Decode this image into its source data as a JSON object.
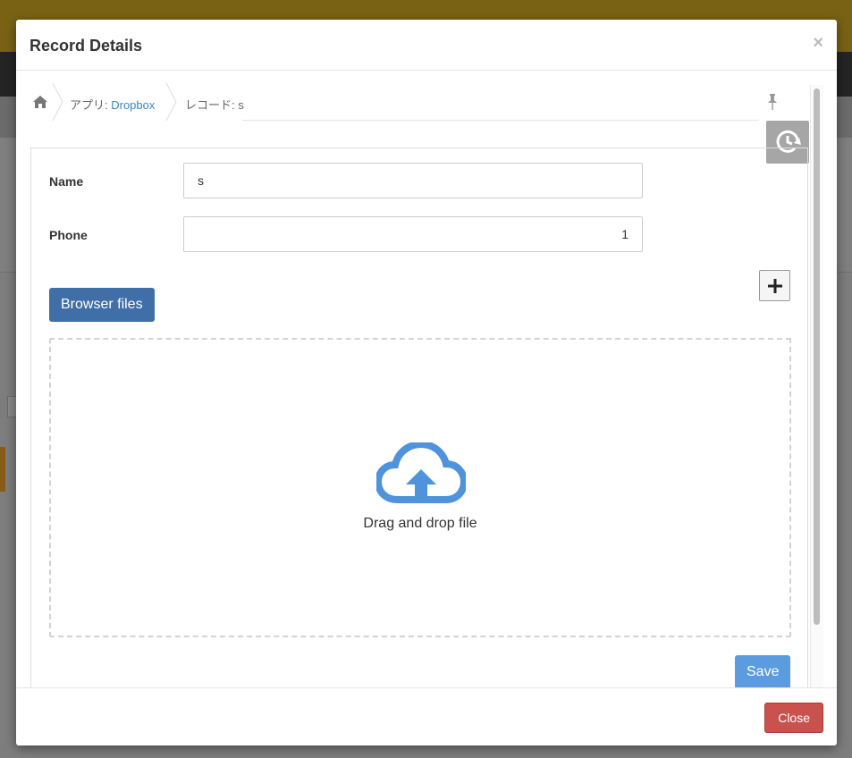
{
  "modal": {
    "title": "Record Details",
    "close_symbol": "×"
  },
  "breadcrumb": {
    "home_icon": "home-icon",
    "app_prefix": "アプリ: ",
    "app_link": "Dropbox",
    "record_label": "レコード: s"
  },
  "form": {
    "name_label": "Name",
    "name_value": "s",
    "phone_label": "Phone",
    "phone_value": "1",
    "browse_label": "Browser files",
    "dropzone_text": "Drag and drop file",
    "save_label": "Save"
  },
  "footer": {
    "close_label": "Close"
  },
  "colors": {
    "primary": "#3f6fa6",
    "save": "#5b9be0",
    "danger": "#c9514e",
    "cloud": "#4f93dc"
  }
}
